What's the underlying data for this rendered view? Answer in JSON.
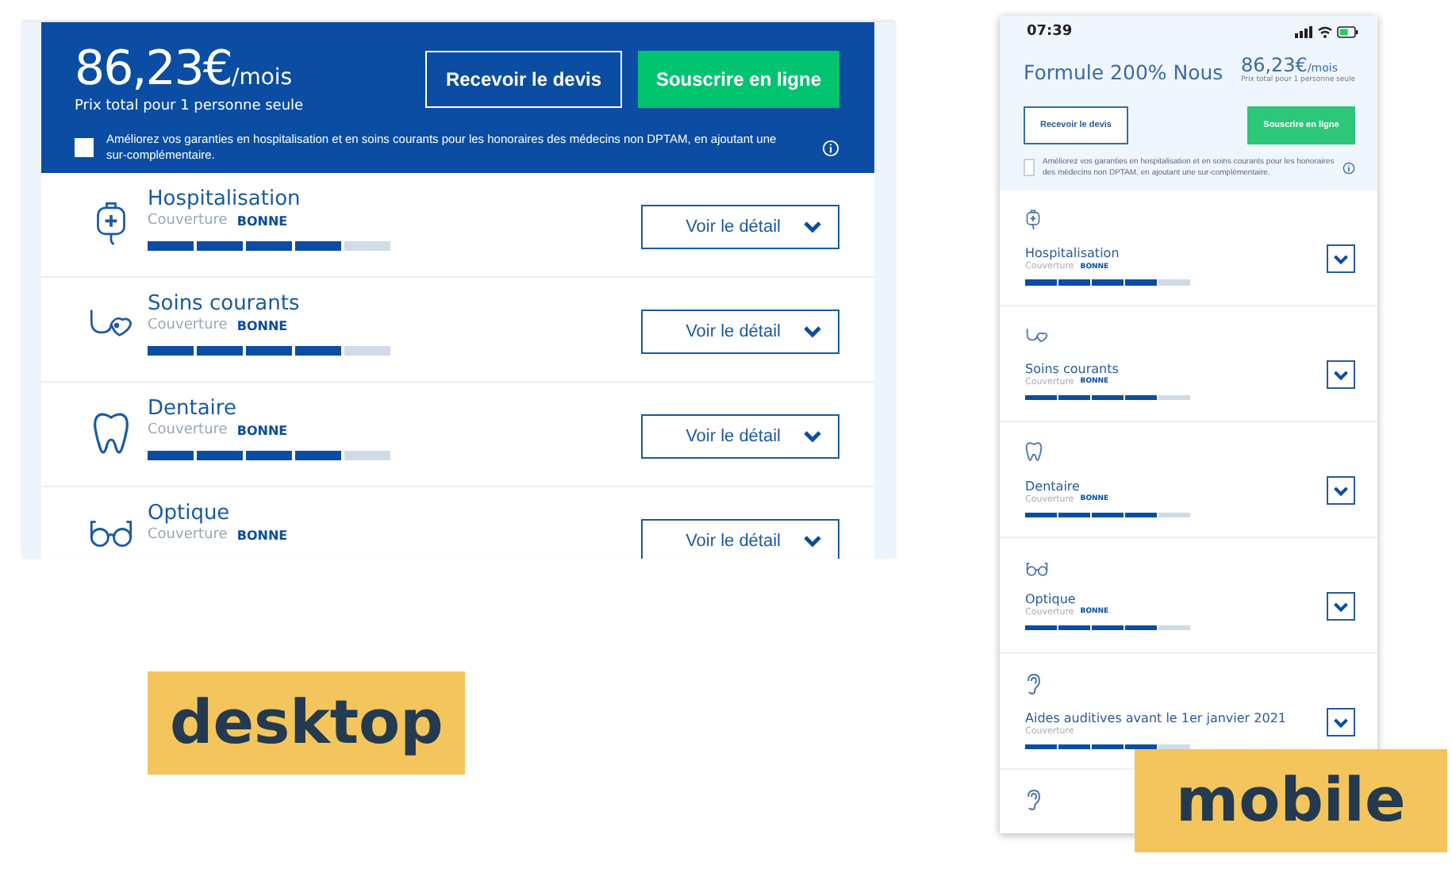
{
  "desktop": {
    "price": {
      "amount": "86,23€",
      "period": "/mois",
      "note": "Prix total pour 1 personne seule"
    },
    "buttons": [
      {
        "label": "Recevoir le devis",
        "kind": "outline"
      },
      {
        "label": "Souscrire en ligne",
        "kind": "primary"
      }
    ],
    "option": {
      "text": "Améliorez vos garanties en hospitalisation et en soins courants pour les honoraires des médecins non DPTAM, en ajoutant une sur-complémentaire.",
      "checked": false
    },
    "categories": [
      {
        "title": "Hospitalisation",
        "coverage_label": "Couverture",
        "rating": "BONNE",
        "level": 0.8,
        "action": "Voir le détail"
      },
      {
        "title": "Soins courants",
        "coverage_label": "Couverture",
        "rating": "BONNE",
        "level": 0.8,
        "action": "Voir le détail"
      },
      {
        "title": "Dentaire",
        "coverage_label": "Couverture",
        "rating": "BONNE",
        "level": 0.8,
        "action": "Voir le détail"
      },
      {
        "title": "Optique",
        "coverage_label": "Couverture",
        "rating": "BONNE",
        "action": "Voir le détail"
      }
    ]
  },
  "mobile": {
    "time": "07:39",
    "plan": "Formule 200% Nous",
    "price": {
      "amount": "86,23€",
      "period": "/mois",
      "note": "Prix total pour 1 personne seule"
    },
    "buttons": [
      {
        "label": "Recevoir le devis",
        "kind": "outline"
      },
      {
        "label": "Souscrire en ligne",
        "kind": "primary"
      }
    ],
    "option": {
      "text": "Améliorez vos garanties en hospitalisation et en soins courants pour les honoraires des médecins non DPTAM, en ajoutant une sur-complémentaire.",
      "checked": false
    },
    "categories": [
      {
        "title": "Hospitalisation",
        "coverage_label": "Couverture",
        "rating": "BONNE",
        "level": 0.8
      },
      {
        "title": "Soins courants",
        "coverage_label": "Couverture",
        "rating": "BONNE",
        "level": 0.8
      },
      {
        "title": "Dentaire",
        "coverage_label": "Couverture",
        "rating": "BONNE",
        "level": 0.8
      },
      {
        "title": "Optique",
        "coverage_label": "Couverture",
        "rating": "BONNE",
        "level": 0.8
      },
      {
        "title": "Aides auditives avant le 1er janvier 2021",
        "coverage_label": "Couverture",
        "level": 0.8
      },
      {
        "kind": "partial"
      }
    ]
  },
  "captions": [
    "desktop",
    "mobile"
  ]
}
